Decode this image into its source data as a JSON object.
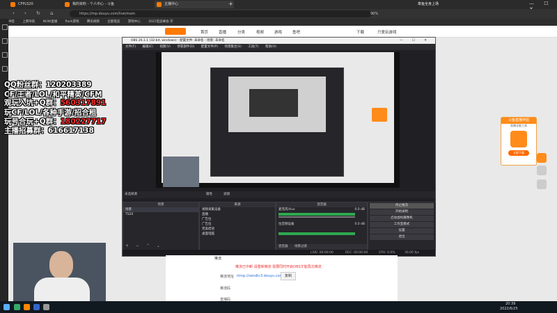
{
  "browser": {
    "tabs": [
      {
        "label": "CFPLS20"
      },
      {
        "label": "我的资料 - 个人中心 - 斗鱼"
      },
      {
        "label": "主播中心"
      }
    ],
    "url": "https://mp.douyu.com/live/main",
    "bookmarks": [
      "书签",
      "上网导航",
      "NOW直播",
      "flash游戏",
      "腾讯视频",
      "企鹅电竞",
      "游戏中心",
      "2021电竞峰会·京"
    ],
    "user_area": "章鱼全身上场",
    "zoom": "90%"
  },
  "douyu": {
    "nav": [
      "首页",
      "直播",
      "分类",
      "视频",
      "游戏",
      "鱼吧"
    ],
    "download": "下载",
    "user": "只爱玩游戏"
  },
  "overlay": {
    "line1": "QQ粉丝群：120203389",
    "line2": "CF/王者/LOL/和平精英/CFM",
    "line3_label": "观玩入坑+Q群：",
    "line3_value": "560317891",
    "line4": "玩CF/LOL/各种手游/招合租",
    "line5_label": "玩号合玩+Q群：",
    "line5_value": "180227717",
    "line6": "主播招募群：616617138"
  },
  "obs": {
    "title": "OBS 26.1.1 (32-bit, windows) - 配置文件: 未命名 - 场景: 未命名",
    "menu": [
      "文件(F)",
      "编辑(E)",
      "视图(V)",
      "停靠部件(D)",
      "配置文件(P)",
      "场景集合(S)",
      "工具(T)",
      "帮助(H)"
    ],
    "source_bar": "未选择源",
    "properties": "属性",
    "filters": "滤镜",
    "scenes_header": "场景",
    "scenes": [
      "场景",
      "TS20"
    ],
    "sources_header": "来源",
    "sources": [
      "视频采集设备",
      "直播",
      "广告位",
      "广告位",
      "完美结语",
      "桌面电脑"
    ],
    "mixer_header": "混音器",
    "mixer": [
      {
        "name": "桌面音频",
        "level": "0.0 dB"
      },
      {
        "name": "麦克风/Aux",
        "level": "0.0 dB"
      },
      {
        "name": "位音频设备",
        "level": "0.0 dB"
      }
    ],
    "mixer_tabs": [
      "混音器",
      "场景过渡"
    ],
    "controls_header": "控件",
    "controls": [
      "停止推流",
      "开始录制",
      "启动虚拟摄像机",
      "工作室模式",
      "设置",
      "退出"
    ],
    "status": {
      "live": "LIVE: 00:00:00",
      "rec": "REC: 00:00:00",
      "cpu": "CPU: 0.0%",
      "fps": "30.00 fps"
    }
  },
  "form": {
    "notice": "推流已中断 请重新推流 需要同时开启OBS才能再次推流",
    "row1_label": "推流地址",
    "row1_link": "rtmp://sendtc3.douyu.com/live",
    "row1_btn": "复制",
    "row2_label": "推流码",
    "row3_label": "直播码",
    "row0_label": "推流"
  },
  "promo": {
    "title": "斗鱼直播伴侣",
    "sub": "直播全能工具",
    "btn": "立即下载"
  },
  "taskbar": {
    "time": "20:39",
    "date": "2022/6/25"
  }
}
